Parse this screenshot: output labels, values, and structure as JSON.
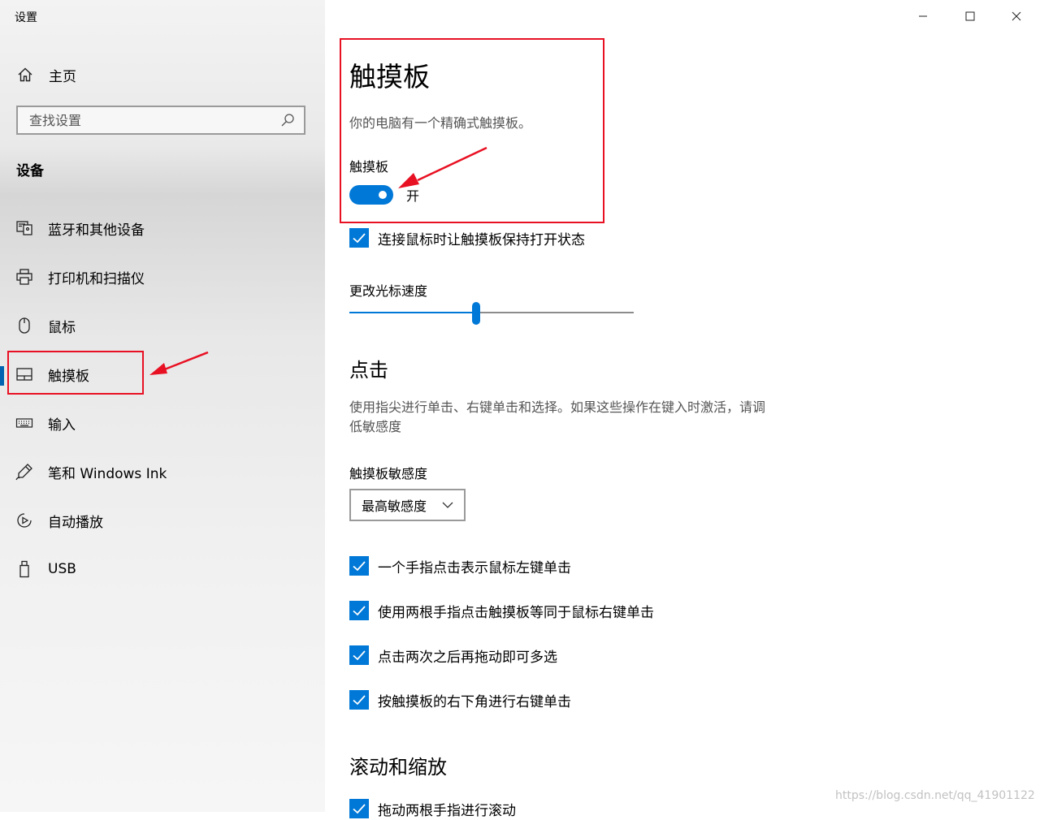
{
  "window": {
    "title": "设置"
  },
  "sidebar": {
    "home_label": "主页",
    "search_placeholder": "查找设置",
    "section_heading": "设备",
    "items": [
      {
        "label": "蓝牙和其他设备",
        "icon": "bluetooth-devices-icon"
      },
      {
        "label": "打印机和扫描仪",
        "icon": "printer-icon"
      },
      {
        "label": "鼠标",
        "icon": "mouse-icon"
      },
      {
        "label": "触摸板",
        "icon": "touchpad-icon",
        "selected": true
      },
      {
        "label": "输入",
        "icon": "keyboard-icon"
      },
      {
        "label": "笔和 Windows Ink",
        "icon": "pen-icon"
      },
      {
        "label": "自动播放",
        "icon": "autoplay-icon"
      },
      {
        "label": "USB",
        "icon": "usb-icon"
      }
    ]
  },
  "main": {
    "title": "触摸板",
    "description": "你的电脑有一个精确式触摸板。",
    "toggle": {
      "label": "触摸板",
      "state_text": "开",
      "on": true
    },
    "keep_on_with_mouse": {
      "label": "连接鼠标时让触摸板保持打开状态",
      "checked": true
    },
    "cursor_speed": {
      "label": "更改光标速度",
      "value_fraction": 0.445
    },
    "taps": {
      "heading": "点击",
      "description_line1": "使用指尖进行单击、右键单击和选择。如果这些操作在键入时激活，请调",
      "description_line2": "低敏感度",
      "sensitivity_label": "触摸板敏感度",
      "sensitivity_value": "最高敏感度",
      "options": [
        {
          "label": "一个手指点击表示鼠标左键单击",
          "checked": true
        },
        {
          "label": "使用两根手指点击触摸板等同于鼠标右键单击",
          "checked": true
        },
        {
          "label": "点击两次之后再拖动即可多选",
          "checked": true
        },
        {
          "label": "按触摸板的右下角进行右键单击",
          "checked": true
        }
      ]
    },
    "scroll": {
      "heading": "滚动和缩放",
      "first_option": {
        "label": "拖动两根手指进行滚动",
        "checked": true
      }
    }
  },
  "watermark": "https://blog.csdn.net/qq_41901122",
  "colors": {
    "accent": "#0078d7",
    "annotation": "#e81123",
    "sidebar_bg": "#ececec"
  }
}
